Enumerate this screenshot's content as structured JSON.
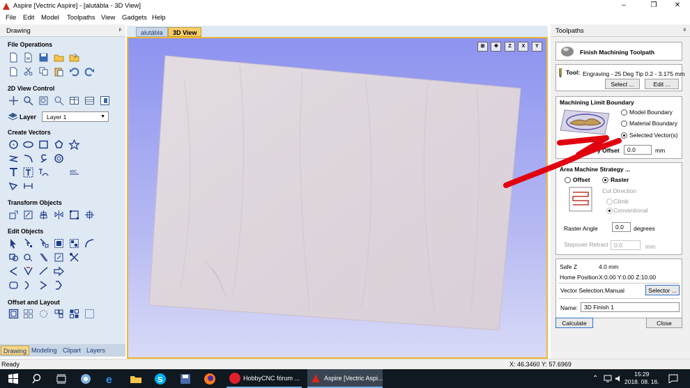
{
  "window": {
    "title": "Aspire [Vectric Aspire] - [alutábla - 3D View]",
    "minimize": "–",
    "maximize": "❐",
    "close": "✕"
  },
  "menu": [
    "File",
    "Edit",
    "Model",
    "Toolpaths",
    "View",
    "Gadgets",
    "Help"
  ],
  "left_panel": {
    "title": "Drawing",
    "pin": "ᵖ",
    "sections": {
      "file_operations": "File Operations",
      "view_control": "2D View Control",
      "create_vectors": "Create Vectors",
      "transform_objects": "Transform Objects",
      "edit_objects": "Edit Objects",
      "offset_layout": "Offset and Layout"
    },
    "layer_label": "Layer",
    "layer_value": "Layer 1",
    "bottom_tabs": [
      "Drawing",
      "Modeling",
      "Clipart",
      "Layers"
    ]
  },
  "doc_tabs": [
    "alutábla",
    "3D View"
  ],
  "view_icons": [
    "⊞",
    "✥",
    "Z",
    "X",
    "Y"
  ],
  "toolpaths": {
    "panel_title": "Toolpaths",
    "heading": "Finish Machining Toolpath",
    "tool_label": "Tool:",
    "tool_value": "Engraving - 25 Deg Tip 0.2 - 3.175 mm",
    "select_btn": "Select ...",
    "edit_btn": "Edit ...",
    "mlb_title": "Machining Limit Boundary",
    "mlb_options": [
      "Model Boundary",
      "Material Boundary",
      "Selected Vector(s)"
    ],
    "mlb_selected": 2,
    "offset_label": "y Offset",
    "offset_value": "0.0",
    "offset_unit": "mm",
    "ams_title": "Area Machine Strategy ...",
    "offset_radio": "Offset",
    "raster_radio": "Raster",
    "cut_direction": "Cut Direction",
    "climb": "Climb",
    "conventional": "Conventional",
    "raster_angle_label": "Raster Angle",
    "raster_angle_value": "0.0",
    "raster_angle_unit": "degrees",
    "stepover_label": "Stepover Retract",
    "stepover_value": "0.0",
    "stepover_unit": "mm",
    "safe_z_label": "Safe Z",
    "safe_z_value": "4.0 mm",
    "home_label": "Home Position",
    "home_value": "X:0.00 Y:0.00 Z:10.00",
    "vector_sel_label": "Vector Selection:",
    "vector_sel_value": "Manual",
    "selector_btn": "Selector ...",
    "name_label": "Name:",
    "name_value": "3D Finish 1",
    "calculate_btn": "Calculate",
    "close_btn": "Close"
  },
  "status": {
    "left": "Ready",
    "coords": "X: 46.3460 Y: 57.6969"
  },
  "taskbar": {
    "tasks": [
      "HobbyCNC fórum ...",
      "Aspire [Vectric Aspi..."
    ],
    "time": "15:29",
    "date": "2018. 08. 16."
  },
  "colors": {
    "accent": "#f2b830",
    "annotation": "#e0000f",
    "panel": "#dfe9f4",
    "board": "#ddd4dc"
  }
}
